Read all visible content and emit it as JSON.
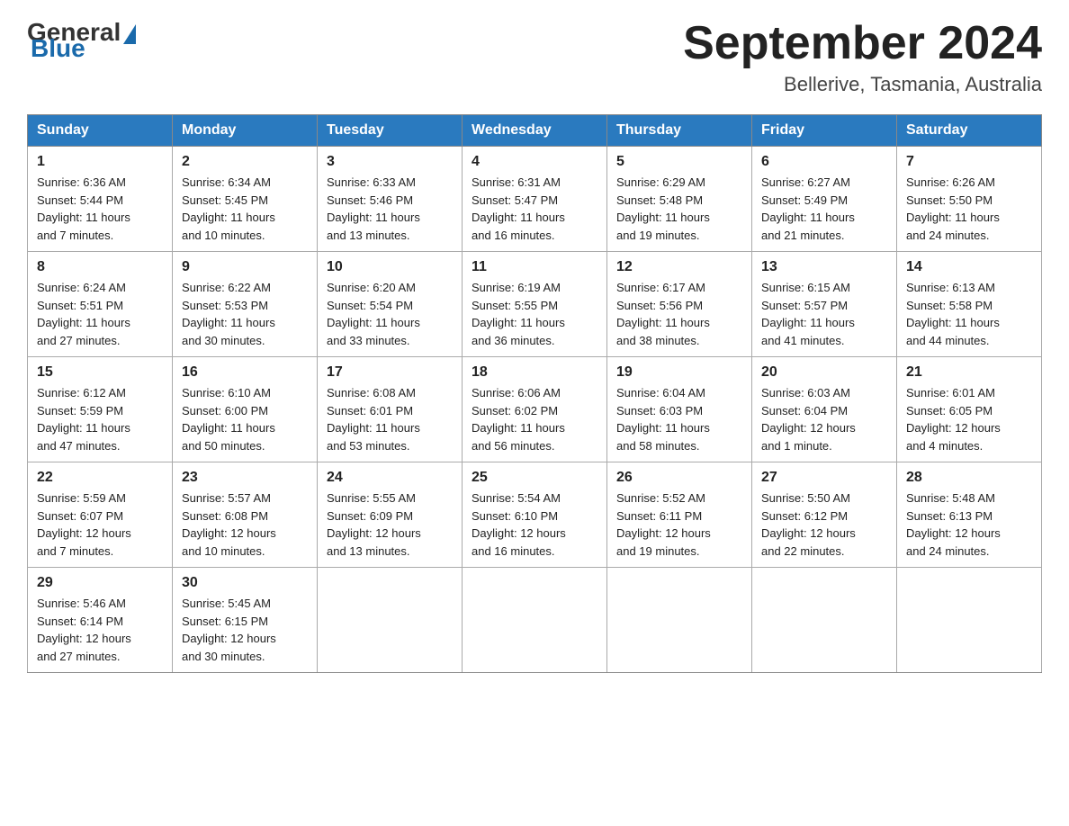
{
  "header": {
    "logo": {
      "general": "General",
      "blue": "Blue"
    },
    "title": "September 2024",
    "location": "Bellerive, Tasmania, Australia"
  },
  "days_of_week": [
    "Sunday",
    "Monday",
    "Tuesday",
    "Wednesday",
    "Thursday",
    "Friday",
    "Saturday"
  ],
  "weeks": [
    [
      {
        "day": "1",
        "sunrise": "6:36 AM",
        "sunset": "5:44 PM",
        "daylight": "11 hours and 7 minutes."
      },
      {
        "day": "2",
        "sunrise": "6:34 AM",
        "sunset": "5:45 PM",
        "daylight": "11 hours and 10 minutes."
      },
      {
        "day": "3",
        "sunrise": "6:33 AM",
        "sunset": "5:46 PM",
        "daylight": "11 hours and 13 minutes."
      },
      {
        "day": "4",
        "sunrise": "6:31 AM",
        "sunset": "5:47 PM",
        "daylight": "11 hours and 16 minutes."
      },
      {
        "day": "5",
        "sunrise": "6:29 AM",
        "sunset": "5:48 PM",
        "daylight": "11 hours and 19 minutes."
      },
      {
        "day": "6",
        "sunrise": "6:27 AM",
        "sunset": "5:49 PM",
        "daylight": "11 hours and 21 minutes."
      },
      {
        "day": "7",
        "sunrise": "6:26 AM",
        "sunset": "5:50 PM",
        "daylight": "11 hours and 24 minutes."
      }
    ],
    [
      {
        "day": "8",
        "sunrise": "6:24 AM",
        "sunset": "5:51 PM",
        "daylight": "11 hours and 27 minutes."
      },
      {
        "day": "9",
        "sunrise": "6:22 AM",
        "sunset": "5:53 PM",
        "daylight": "11 hours and 30 minutes."
      },
      {
        "day": "10",
        "sunrise": "6:20 AM",
        "sunset": "5:54 PM",
        "daylight": "11 hours and 33 minutes."
      },
      {
        "day": "11",
        "sunrise": "6:19 AM",
        "sunset": "5:55 PM",
        "daylight": "11 hours and 36 minutes."
      },
      {
        "day": "12",
        "sunrise": "6:17 AM",
        "sunset": "5:56 PM",
        "daylight": "11 hours and 38 minutes."
      },
      {
        "day": "13",
        "sunrise": "6:15 AM",
        "sunset": "5:57 PM",
        "daylight": "11 hours and 41 minutes."
      },
      {
        "day": "14",
        "sunrise": "6:13 AM",
        "sunset": "5:58 PM",
        "daylight": "11 hours and 44 minutes."
      }
    ],
    [
      {
        "day": "15",
        "sunrise": "6:12 AM",
        "sunset": "5:59 PM",
        "daylight": "11 hours and 47 minutes."
      },
      {
        "day": "16",
        "sunrise": "6:10 AM",
        "sunset": "6:00 PM",
        "daylight": "11 hours and 50 minutes."
      },
      {
        "day": "17",
        "sunrise": "6:08 AM",
        "sunset": "6:01 PM",
        "daylight": "11 hours and 53 minutes."
      },
      {
        "day": "18",
        "sunrise": "6:06 AM",
        "sunset": "6:02 PM",
        "daylight": "11 hours and 56 minutes."
      },
      {
        "day": "19",
        "sunrise": "6:04 AM",
        "sunset": "6:03 PM",
        "daylight": "11 hours and 58 minutes."
      },
      {
        "day": "20",
        "sunrise": "6:03 AM",
        "sunset": "6:04 PM",
        "daylight": "12 hours and 1 minute."
      },
      {
        "day": "21",
        "sunrise": "6:01 AM",
        "sunset": "6:05 PM",
        "daylight": "12 hours and 4 minutes."
      }
    ],
    [
      {
        "day": "22",
        "sunrise": "5:59 AM",
        "sunset": "6:07 PM",
        "daylight": "12 hours and 7 minutes."
      },
      {
        "day": "23",
        "sunrise": "5:57 AM",
        "sunset": "6:08 PM",
        "daylight": "12 hours and 10 minutes."
      },
      {
        "day": "24",
        "sunrise": "5:55 AM",
        "sunset": "6:09 PM",
        "daylight": "12 hours and 13 minutes."
      },
      {
        "day": "25",
        "sunrise": "5:54 AM",
        "sunset": "6:10 PM",
        "daylight": "12 hours and 16 minutes."
      },
      {
        "day": "26",
        "sunrise": "5:52 AM",
        "sunset": "6:11 PM",
        "daylight": "12 hours and 19 minutes."
      },
      {
        "day": "27",
        "sunrise": "5:50 AM",
        "sunset": "6:12 PM",
        "daylight": "12 hours and 22 minutes."
      },
      {
        "day": "28",
        "sunrise": "5:48 AM",
        "sunset": "6:13 PM",
        "daylight": "12 hours and 24 minutes."
      }
    ],
    [
      {
        "day": "29",
        "sunrise": "5:46 AM",
        "sunset": "6:14 PM",
        "daylight": "12 hours and 27 minutes."
      },
      {
        "day": "30",
        "sunrise": "5:45 AM",
        "sunset": "6:15 PM",
        "daylight": "12 hours and 30 minutes."
      },
      null,
      null,
      null,
      null,
      null
    ]
  ],
  "labels": {
    "sunrise": "Sunrise:",
    "sunset": "Sunset:",
    "daylight": "Daylight:"
  }
}
